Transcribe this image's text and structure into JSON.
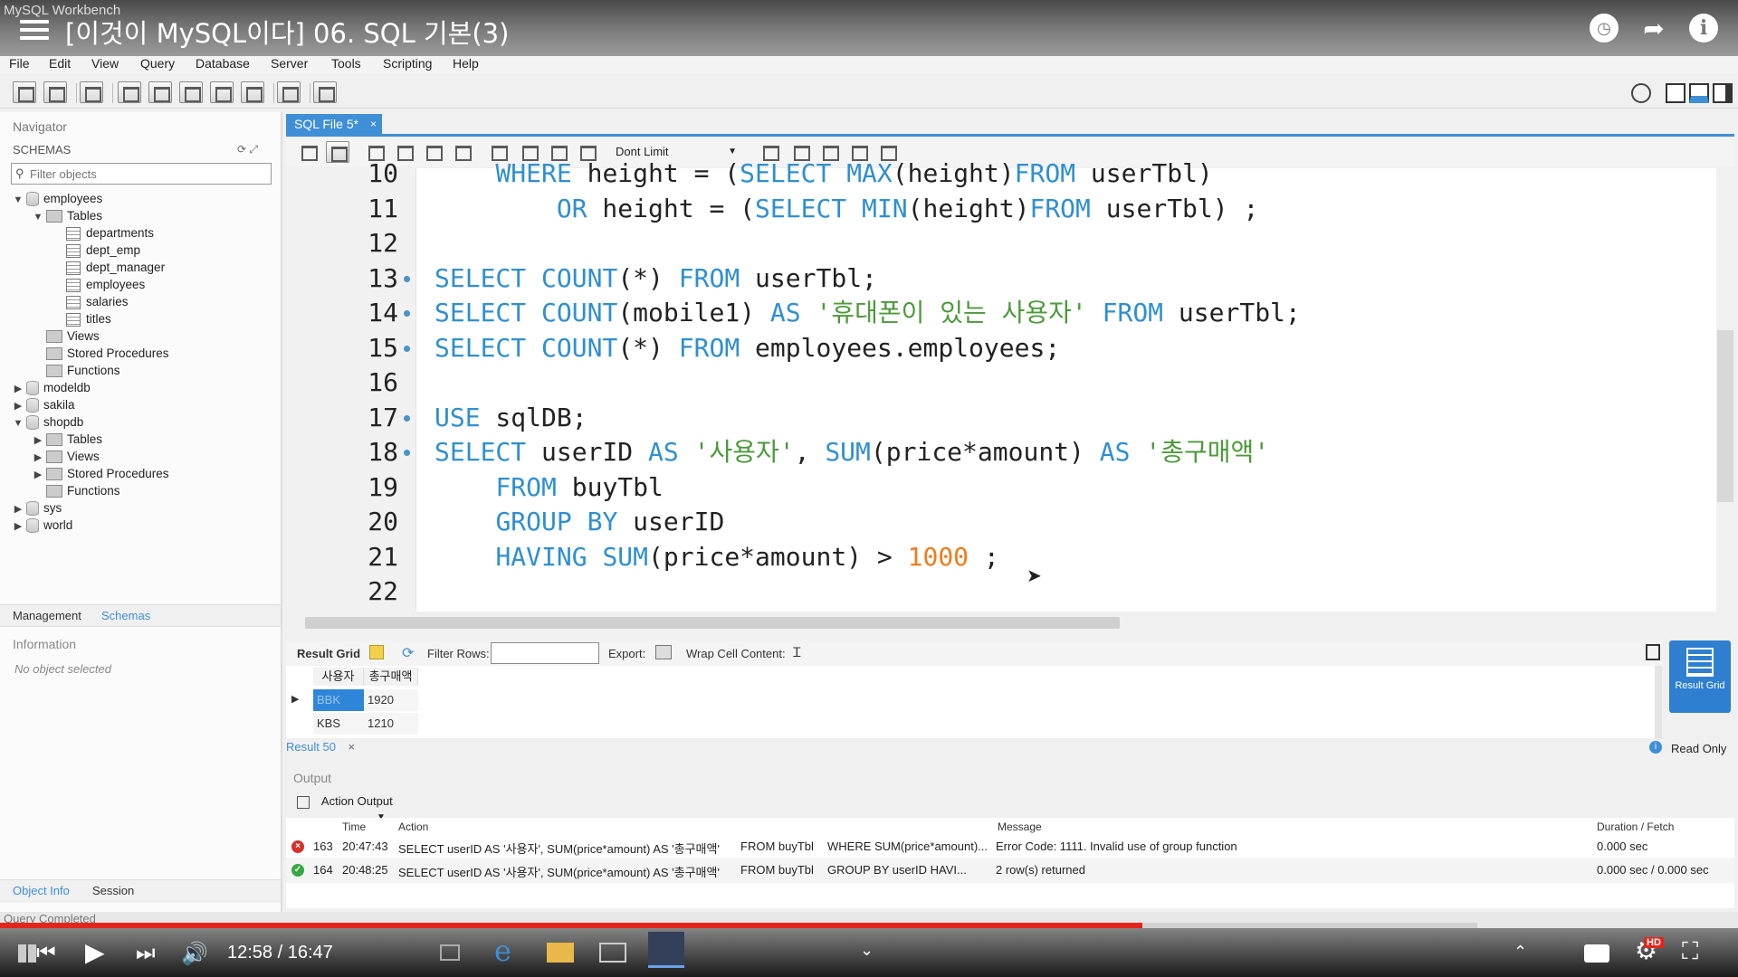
{
  "window_title": "MySQL Workbench",
  "video": {
    "title": "[이것이 MySQL이다] 06. SQL 기본(3)",
    "time": "12:58 / 16:47",
    "progress": 0.773,
    "hd_badge": "HD"
  },
  "menu": [
    "File",
    "Edit",
    "View",
    "Query",
    "Database",
    "Server",
    "Tools",
    "Scripting",
    "Help"
  ],
  "navigator": {
    "header": "Navigator",
    "schemas_label": "SCHEMAS",
    "filter_placeholder": "Filter objects",
    "tree": [
      {
        "label": "employees",
        "level": 0,
        "expanded": true,
        "type": "db"
      },
      {
        "label": "Tables",
        "level": 1,
        "expanded": true,
        "type": "folder"
      },
      {
        "label": "departments",
        "level": 2,
        "type": "table"
      },
      {
        "label": "dept_emp",
        "level": 2,
        "type": "table"
      },
      {
        "label": "dept_manager",
        "level": 2,
        "type": "table"
      },
      {
        "label": "employees",
        "level": 2,
        "type": "table"
      },
      {
        "label": "salaries",
        "level": 2,
        "type": "table"
      },
      {
        "label": "titles",
        "level": 2,
        "type": "table"
      },
      {
        "label": "Views",
        "level": 1,
        "type": "folder-leaf"
      },
      {
        "label": "Stored Procedures",
        "level": 1,
        "type": "folder-leaf"
      },
      {
        "label": "Functions",
        "level": 1,
        "type": "folder-leaf"
      },
      {
        "label": "modeldb",
        "level": 0,
        "expanded": false,
        "type": "db"
      },
      {
        "label": "sakila",
        "level": 0,
        "expanded": false,
        "type": "db"
      },
      {
        "label": "shopdb",
        "level": 0,
        "expanded": true,
        "type": "db"
      },
      {
        "label": "Tables",
        "level": 1,
        "expanded": false,
        "type": "folder"
      },
      {
        "label": "Views",
        "level": 1,
        "expanded": false,
        "type": "folder"
      },
      {
        "label": "Stored Procedures",
        "level": 1,
        "expanded": false,
        "type": "folder"
      },
      {
        "label": "Functions",
        "level": 1,
        "type": "folder-leaf"
      },
      {
        "label": "sys",
        "level": 0,
        "expanded": false,
        "type": "db"
      },
      {
        "label": "world",
        "level": 0,
        "expanded": false,
        "type": "db"
      }
    ],
    "tabs": [
      "Management",
      "Schemas"
    ],
    "info_header": "Information",
    "no_object": "No object selected",
    "bottom_tabs": [
      "Object Info",
      "Session"
    ]
  },
  "editor": {
    "tab_label": "SQL File 5*",
    "limit": "Dont Limit",
    "lines": [
      {
        "n": "10",
        "dot": false,
        "tokens": [
          [
            "",
            "    "
          ],
          [
            "kw",
            "WHERE"
          ],
          [
            "",
            " height = ("
          ],
          [
            "kw",
            "SELECT"
          ],
          [
            "",
            " "
          ],
          [
            "fn",
            "MAX"
          ],
          [
            "",
            "(height)"
          ],
          [
            "kw",
            "FROM"
          ],
          [
            "",
            " userTbl)"
          ]
        ]
      },
      {
        "n": "11",
        "dot": false,
        "tokens": [
          [
            "",
            "        "
          ],
          [
            "kw",
            "OR"
          ],
          [
            "",
            " height = ("
          ],
          [
            "kw",
            "SELECT"
          ],
          [
            "",
            " "
          ],
          [
            "fn",
            "MIN"
          ],
          [
            "",
            "(height)"
          ],
          [
            "kw",
            "FROM"
          ],
          [
            "",
            " userTbl) ;"
          ]
        ]
      },
      {
        "n": "12",
        "dot": false,
        "tokens": []
      },
      {
        "n": "13",
        "dot": true,
        "tokens": [
          [
            "kw",
            "SELECT"
          ],
          [
            "",
            " "
          ],
          [
            "fn",
            "COUNT"
          ],
          [
            "",
            "(*) "
          ],
          [
            "kw",
            "FROM"
          ],
          [
            "",
            " userTbl;"
          ]
        ]
      },
      {
        "n": "14",
        "dot": true,
        "tokens": [
          [
            "kw",
            "SELECT"
          ],
          [
            "",
            " "
          ],
          [
            "fn",
            "COUNT"
          ],
          [
            "",
            "(mobile1) "
          ],
          [
            "kw",
            "AS"
          ],
          [
            "",
            " "
          ],
          [
            "st",
            "'휴대폰이 있는 사용자'"
          ],
          [
            "",
            " "
          ],
          [
            "kw",
            "FROM"
          ],
          [
            "",
            " userTbl;"
          ]
        ]
      },
      {
        "n": "15",
        "dot": true,
        "tokens": [
          [
            "kw",
            "SELECT"
          ],
          [
            "",
            " "
          ],
          [
            "fn",
            "COUNT"
          ],
          [
            "",
            "(*) "
          ],
          [
            "kw",
            "FROM"
          ],
          [
            "",
            " employees.employees;"
          ]
        ]
      },
      {
        "n": "16",
        "dot": false,
        "tokens": []
      },
      {
        "n": "17",
        "dot": true,
        "tokens": [
          [
            "kw",
            "USE"
          ],
          [
            "",
            " sqlDB;"
          ]
        ]
      },
      {
        "n": "18",
        "dot": true,
        "tokens": [
          [
            "kw",
            "SELECT"
          ],
          [
            "",
            " userID "
          ],
          [
            "kw",
            "AS"
          ],
          [
            "",
            " "
          ],
          [
            "st",
            "'사용자'"
          ],
          [
            "",
            ", "
          ],
          [
            "fn",
            "SUM"
          ],
          [
            "",
            "(price*amount) "
          ],
          [
            "kw",
            "AS"
          ],
          [
            "",
            " "
          ],
          [
            "st",
            "'총구매액'"
          ]
        ]
      },
      {
        "n": "19",
        "dot": false,
        "tokens": [
          [
            "",
            "    "
          ],
          [
            "kw",
            "FROM"
          ],
          [
            "",
            " buyTbl"
          ]
        ]
      },
      {
        "n": "20",
        "dot": false,
        "tokens": [
          [
            "",
            "    "
          ],
          [
            "kw",
            "GROUP BY"
          ],
          [
            "",
            " userID"
          ]
        ]
      },
      {
        "n": "21",
        "dot": false,
        "tokens": [
          [
            "",
            "    "
          ],
          [
            "kw",
            "HAVING"
          ],
          [
            "",
            " "
          ],
          [
            "fn",
            "SUM"
          ],
          [
            "",
            "(price*amount) > "
          ],
          [
            "nm",
            "1000"
          ],
          [
            "",
            " ;"
          ]
        ]
      },
      {
        "n": "22",
        "dot": false,
        "tokens": []
      }
    ]
  },
  "result": {
    "grid_label": "Result Grid",
    "filter_label": "Filter Rows:",
    "export_label": "Export:",
    "wrap_label": "Wrap Cell Content:",
    "columns": [
      "사용자",
      "총구매액"
    ],
    "rows": [
      [
        "BBK",
        "1920"
      ],
      [
        "KBS",
        "1210"
      ]
    ],
    "tab_label": "Result 50",
    "read_only": "Read Only",
    "side_button": "Result Grid"
  },
  "output": {
    "header": "Output",
    "selector": "Action Output",
    "columns": [
      "Time",
      "Action",
      "Message",
      "Duration / Fetch"
    ],
    "rows": [
      {
        "status": "error",
        "n": "163",
        "time": "20:47:43",
        "action1": "SELECT userID AS '사용자', SUM(price*amount) AS '총구매액'",
        "action2": "FROM buyTbl",
        "action3": "WHERE SUM(price*amount)...",
        "message": "Error Code: 1111. Invalid use of group function",
        "duration": "0.000 sec"
      },
      {
        "status": "ok",
        "n": "164",
        "time": "20:48:25",
        "action1": "SELECT userID AS '사용자', SUM(price*amount) AS '총구매액'",
        "action2": "FROM buyTbl",
        "action3": "GROUP BY userID    HAVI...",
        "message": "2 row(s) returned",
        "duration": "0.000 sec / 0.000 sec"
      }
    ]
  },
  "status_text": "Query Completed"
}
